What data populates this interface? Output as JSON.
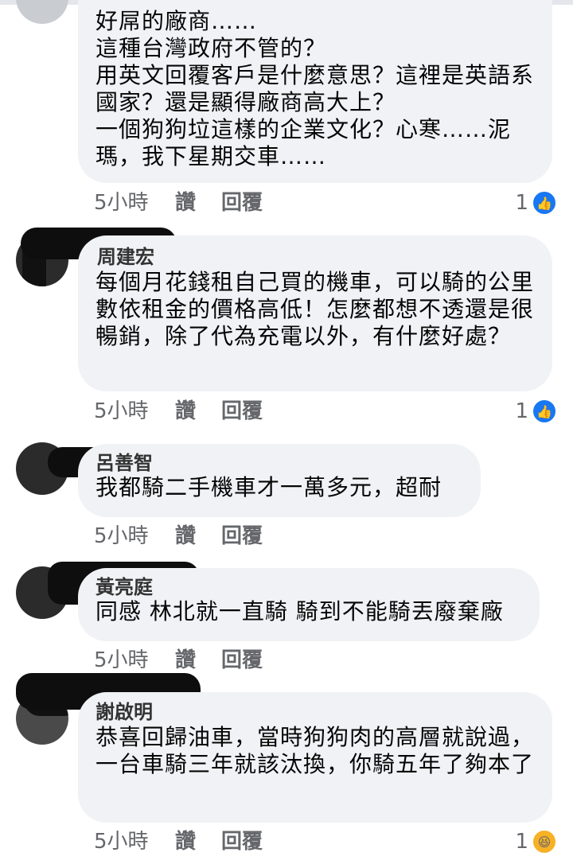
{
  "comments": [
    {
      "text": "好屌的廠商……\n這種台灣政府不管的？\n用英文回覆客戶是什麼意思？這裡是英語系國家？還是顯得廠商高大上？\n一個狗狗垃這樣的企業文化？心寒……泥瑪，我下星期交車……",
      "time": "5小時",
      "like_label": "讚",
      "reply_label": "回覆",
      "reaction_count": "1",
      "reaction_icon": "like-icon"
    },
    {
      "author": "周建宏",
      "text": "每個月花錢租自己買的機車，可以騎的公里數依租金的價格高低！怎麼都想不透還是很暢銷，除了代為充電以外，有什麼好處？",
      "time": "5小時",
      "like_label": "讚",
      "reply_label": "回覆",
      "reaction_count": "1",
      "reaction_icon": "like-icon"
    },
    {
      "author": "呂善智",
      "text": "我都騎二手機車才一萬多元，超耐",
      "time": "5小時",
      "like_label": "讚",
      "reply_label": "回覆"
    },
    {
      "author": "黃亮庭",
      "text": "同感 林北就一直騎 騎到不能騎丟廢棄廠",
      "time": "5小時",
      "like_label": "讚",
      "reply_label": "回覆"
    },
    {
      "author": "謝啟明",
      "text": "恭喜回歸油車，當時狗狗肉的高層就說過，一台車騎三年就該汰換，你騎五年了夠本了",
      "time": "5小時",
      "like_label": "讚",
      "reply_label": "回覆",
      "reaction_count": "1",
      "reaction_icon": "haha-icon"
    }
  ]
}
